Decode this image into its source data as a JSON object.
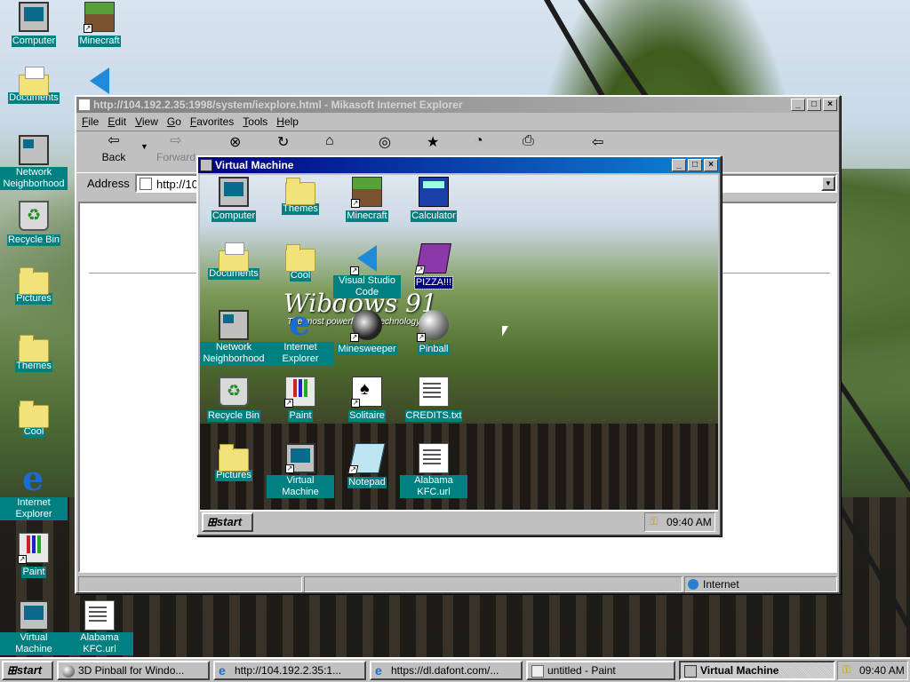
{
  "desktop_icons": [
    {
      "label": "Computer",
      "icon": "computer-icon"
    },
    {
      "label": "Minecraft",
      "icon": "minecraft-icon"
    },
    {
      "label": "Documents",
      "icon": "documents-icon"
    },
    {
      "label": "Network Neighborhood",
      "icon": "network-icon"
    },
    {
      "label": "Recycle Bin",
      "icon": "recycle-bin-icon"
    },
    {
      "label": "Pictures",
      "icon": "folder-icon"
    },
    {
      "label": "Themes",
      "icon": "folder-icon"
    },
    {
      "label": "Cool",
      "icon": "folder-icon"
    },
    {
      "label": "Internet Explorer",
      "icon": "ie-icon"
    },
    {
      "label": "Paint",
      "icon": "paint-icon"
    },
    {
      "label": "Virtual Machine",
      "icon": "computer-icon"
    },
    {
      "label": "Alabama KFC.url",
      "icon": "ie-doc-icon"
    }
  ],
  "browser": {
    "title": "http://104.192.2.35:1998/system/iexplore.html - Mikasoft Internet Explorer",
    "menu": [
      "File",
      "Edit",
      "View",
      "Go",
      "Favorites",
      "Tools",
      "Help"
    ],
    "toolbar": {
      "back": "Back",
      "forward": "Forward"
    },
    "address_label": "Address",
    "address_value": "http://104.192.2.35:1998/system/iexplore.html",
    "status_zone": "Internet"
  },
  "vm": {
    "title": "Virtual Machine",
    "icons": [
      {
        "label": "Computer",
        "icon": "computer-icon"
      },
      {
        "label": "Themes",
        "icon": "folder-icon"
      },
      {
        "label": "Minecraft",
        "icon": "minecraft-icon"
      },
      {
        "label": "Calculator",
        "icon": "calculator-icon"
      },
      {
        "label": "Documents",
        "icon": "documents-icon"
      },
      {
        "label": "Cool",
        "icon": "folder-icon"
      },
      {
        "label": "Visual Studio Code",
        "icon": "vscode-icon"
      },
      {
        "label": "PIZZA!!!",
        "icon": "pizza-icon"
      },
      {
        "label": "Network Neighborhood",
        "icon": "network-icon"
      },
      {
        "label": "Internet Explorer",
        "icon": "ie-icon"
      },
      {
        "label": "Minesweeper",
        "icon": "minesweeper-icon"
      },
      {
        "label": "Pinball",
        "icon": "pinball-icon"
      },
      {
        "label": "Recycle Bin",
        "icon": "recycle-bin-icon"
      },
      {
        "label": "Paint",
        "icon": "paint-icon"
      },
      {
        "label": "Solitaire",
        "icon": "solitaire-icon"
      },
      {
        "label": "CREDITS.txt",
        "icon": "text-file-icon"
      },
      {
        "label": "Pictures",
        "icon": "folder-icon"
      },
      {
        "label": "Virtual Machine",
        "icon": "computer-icon"
      },
      {
        "label": "Notepad",
        "icon": "notepad-icon"
      },
      {
        "label": "Alabama KFC.url",
        "icon": "ie-doc-icon"
      }
    ],
    "wallpaper_title": "Wibdows 91",
    "wallpaper_subtitle": "The most powerful PC technology ever!",
    "start_label": "start",
    "clock": "09:40 AM"
  },
  "taskbar": {
    "start_label": "start",
    "tasks": [
      {
        "label": "3D Pinball for Windo...",
        "icon": "pinball-icon"
      },
      {
        "label": "http://104.192.2.35:1...",
        "icon": "ie-icon"
      },
      {
        "label": "https://dl.dafont.com/...",
        "icon": "ie-icon"
      },
      {
        "label": "untitled - Paint",
        "icon": "paint-icon"
      },
      {
        "label": "Virtual Machine",
        "icon": "computer-icon"
      }
    ],
    "clock": "09:40 AM"
  },
  "colors": {
    "accent": "#000080",
    "desktop_label_bg": "#008080",
    "face": "#c0c0c0"
  }
}
